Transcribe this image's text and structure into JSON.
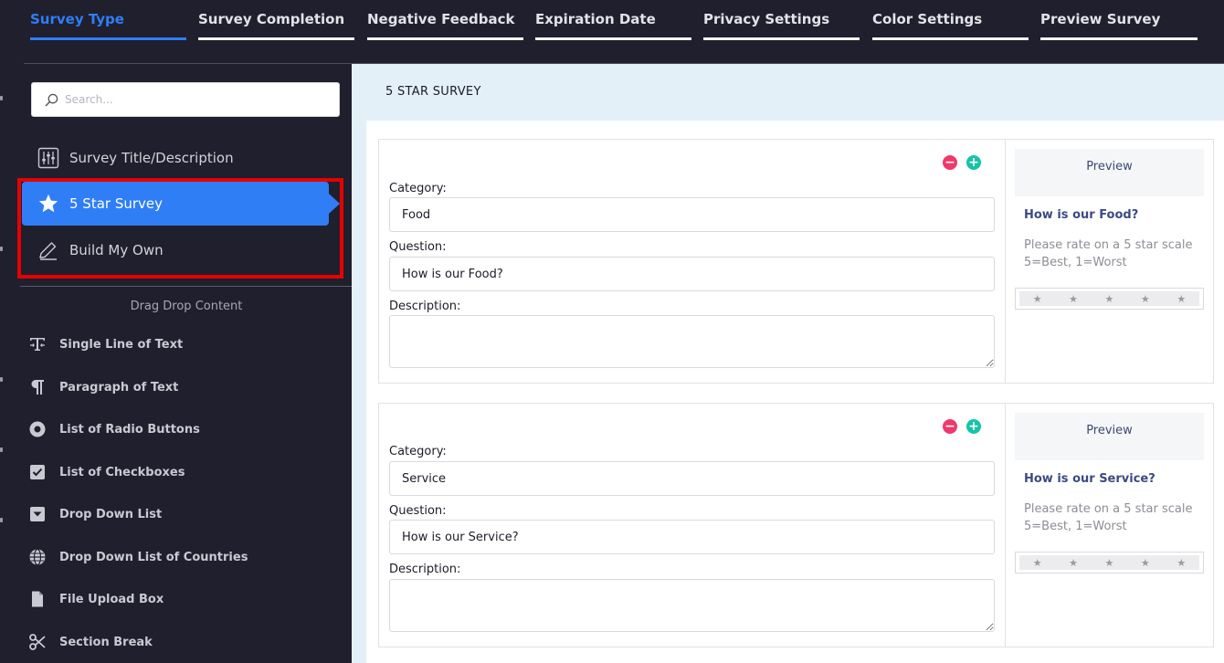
{
  "tabs": [
    {
      "label": "Survey Type",
      "active": true
    },
    {
      "label": "Survey Completion"
    },
    {
      "label": "Negative Feedback"
    },
    {
      "label": "Expiration Date"
    },
    {
      "label": "Privacy Settings"
    },
    {
      "label": "Color Settings"
    },
    {
      "label": "Preview Survey"
    }
  ],
  "sidebar": {
    "search_placeholder": "Search...",
    "survey_types": [
      {
        "label": "Survey Title/Description",
        "icon": "sliders-icon"
      },
      {
        "label": "5 Star Survey",
        "icon": "star-icon",
        "active": true
      },
      {
        "label": "Build My Own",
        "icon": "pencil-icon"
      }
    ],
    "drag_drop_heading": "Drag Drop Content",
    "drag_drop_items": [
      {
        "label": "Single Line of Text",
        "icon": "text-field-icon"
      },
      {
        "label": "Paragraph of Text",
        "icon": "paragraph-icon"
      },
      {
        "label": "List of Radio Buttons",
        "icon": "radio-icon"
      },
      {
        "label": "List of Checkboxes",
        "icon": "checkbox-icon"
      },
      {
        "label": "Drop Down List",
        "icon": "dropdown-icon"
      },
      {
        "label": "Drop Down List of Countries",
        "icon": "globe-icon"
      },
      {
        "label": "File Upload Box",
        "icon": "file-icon"
      },
      {
        "label": "Section Break",
        "icon": "scissors-icon"
      }
    ]
  },
  "main": {
    "title": "5 STAR SURVEY",
    "labels": {
      "category": "Category:",
      "question": "Question:",
      "description": "Description:",
      "preview": "Preview"
    },
    "questions": [
      {
        "category": "Food",
        "question": "How is our Food?",
        "description": "",
        "preview_question": "How is our Food?",
        "preview_description": "Please rate on a 5 star scale 5=Best, 1=Worst"
      },
      {
        "category": "Service",
        "question": "How is our Service?",
        "description": "",
        "preview_question": "How is our Service?",
        "preview_description": "Please rate on a 5 star scale 5=Best, 1=Worst"
      }
    ]
  },
  "colors": {
    "accent": "#2f7ef5",
    "background": "#1f1f2e",
    "remove_button": "#f0386b",
    "add_button": "#14c4a8",
    "highlight": "#e60000"
  }
}
